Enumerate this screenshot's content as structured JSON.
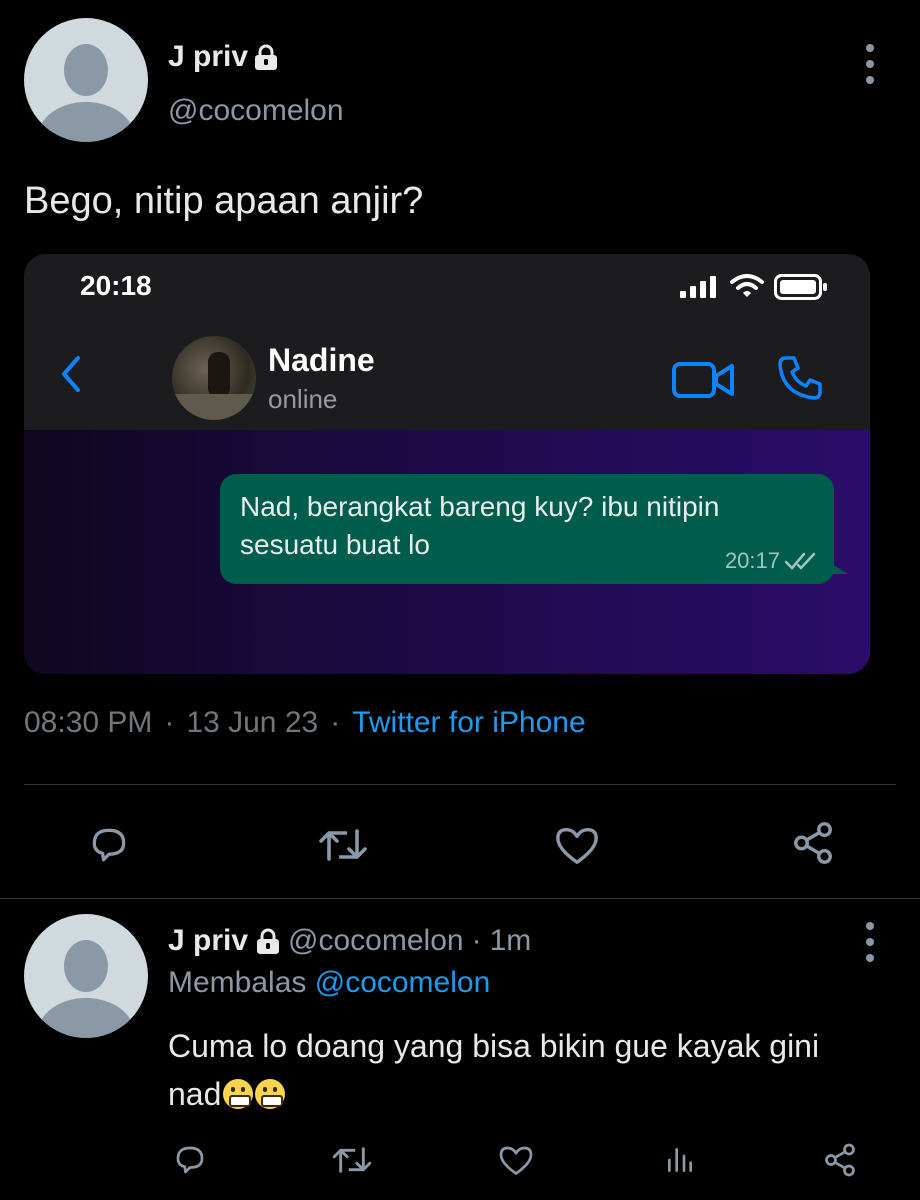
{
  "tweet": {
    "author_name": "J priv",
    "author_handle": "@cocomelon",
    "text": "Bego, nitip apaan anjir?",
    "time": "08:30 PM",
    "separator1": "·",
    "date": "13 Jun 23",
    "separator2": "·",
    "source": "Twitter for iPhone"
  },
  "screenshot": {
    "status_time": "20:18",
    "contact_name": "Nadine",
    "contact_status": "online",
    "message_text": "Nad, berangkat bareng kuy? ibu nitipin sesuatu buat lo",
    "message_time": "20:17",
    "colors": {
      "bubble": "#005c4b",
      "accent": "#0a84ff"
    }
  },
  "reply": {
    "author_name": "J priv",
    "author_handle": "@cocomelon",
    "separator": "·",
    "age": "1m",
    "replying_label": "Membalas",
    "replying_to": "@cocomelon",
    "text": "Cuma lo doang yang bisa bikin gue kayak gini nad"
  },
  "icons": [
    "lock-icon",
    "more-icon",
    "back-chevron-icon",
    "video-icon",
    "phone-icon",
    "signal-icon",
    "wifi-icon",
    "battery-icon",
    "double-check-icon",
    "reply-icon",
    "retweet-icon",
    "like-icon",
    "share-icon",
    "analytics-icon"
  ],
  "colors": {
    "background": "#000000",
    "link": "#1d9bf0",
    "muted": "#71767b"
  }
}
